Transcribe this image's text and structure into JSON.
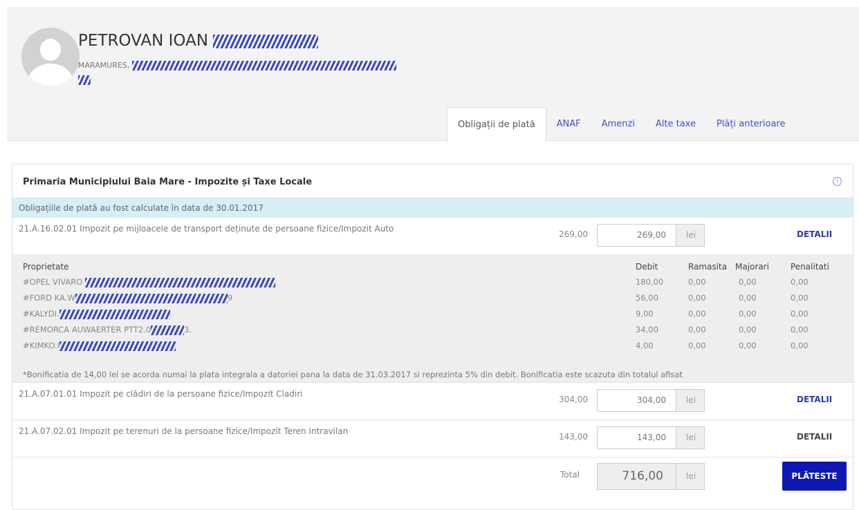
{
  "user": {
    "name": "PETROVAN IOAN",
    "address_prefix": "MARAMURES,"
  },
  "tabs": [
    {
      "label": "Obligații de plată",
      "active": true
    },
    {
      "label": "ANAF"
    },
    {
      "label": "Amenzi"
    },
    {
      "label": "Alte taxe"
    },
    {
      "label": "Plăți anterioare"
    }
  ],
  "panel": {
    "title": "Primaria Municipiului Baia Mare - Impozite și Taxe Locale",
    "info_icon": "i",
    "calc_notice": "Obligațiile de plată au fost calculate în data de 30.01.2017"
  },
  "obligations": [
    {
      "label": "21.A.16.02.01 Impozit pe mijloacele de transport deținute de persoane fizice/Impozit Auto",
      "amount": "269,00",
      "input_value": "269,00",
      "unit": "lei",
      "details_label": "DETALII"
    },
    {
      "label": "21.A.07.01.01 Impozit pe clădiri de la persoane fizice/Impozit Cladiri",
      "amount": "304,00",
      "input_value": "304,00",
      "unit": "lei",
      "details_label": "DETALII"
    },
    {
      "label": "21.A.07.02.01 Impozit pe terenuri de la persoane fizice/Impozit Teren Intravilan",
      "amount": "143,00",
      "input_value": "143,00",
      "unit": "lei",
      "details_label": "DETALII"
    }
  ],
  "details": {
    "headers": {
      "property": "Proprietate",
      "debit": "Debit",
      "remaining": "Ramasita",
      "surcharges": "Majorari",
      "penalties": "Penalitati"
    },
    "rows": [
      {
        "property": "#OPEL VIVARO",
        "debit": "180,00",
        "remaining": "0,00",
        "surcharges": "0,00",
        "penalties": "0,00"
      },
      {
        "property": "#FORD KA.W",
        "property_suffix": "9",
        "debit": "56,00",
        "remaining": "0,00",
        "surcharges": "0,00",
        "penalties": "0,00"
      },
      {
        "property": "#KALYDI.",
        "property_suffix": ".",
        "debit": "9,00",
        "remaining": "0,00",
        "surcharges": "0,00",
        "penalties": "0,00"
      },
      {
        "property": "#REMORCA AUWAERTER PTT2.0",
        "property_suffix": "3.",
        "debit": "34,00",
        "remaining": "0,00",
        "surcharges": "0,00",
        "penalties": "0,00"
      },
      {
        "property": "#KIMKO.I",
        "debit": "4,00",
        "remaining": "0,00",
        "surcharges": "0,00",
        "penalties": "0,00"
      }
    ],
    "note": "*Bonificatia de 14,00 lei se acorda numai la plata integrala a datoriei pana la data de 31.03.2017 si reprezinta 5% din debit. Bonificatia este scazuta din totalul afisat"
  },
  "total": {
    "label": "Total",
    "value": "716,00",
    "unit": "lei",
    "pay_label": "PLĂTESTE"
  },
  "colors": {
    "accent": "#0e19b3",
    "link": "#2b3aa8",
    "banner": "#d8edf6"
  }
}
